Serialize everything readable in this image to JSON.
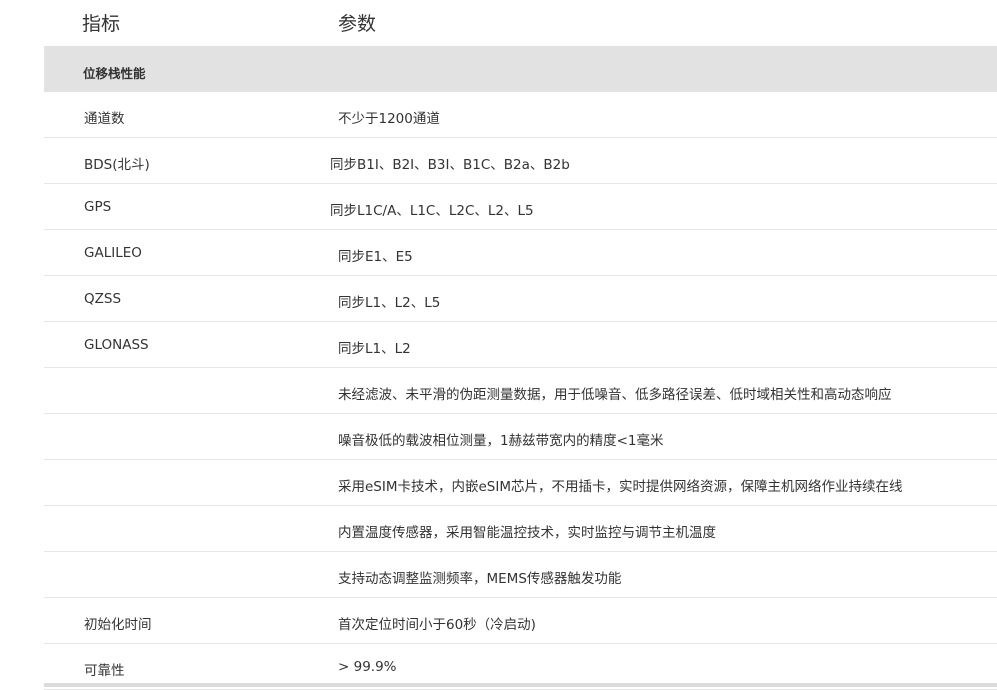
{
  "header": {
    "col1": "指标",
    "col2": "参数"
  },
  "section": {
    "label": "位移栈性能"
  },
  "rows": [
    {
      "name": "通道数",
      "value": "不少于1200通道"
    },
    {
      "name": "BDS(北斗)",
      "value": "同步B1I、B2I、B3I、B1C、B2a、B2b"
    },
    {
      "name": "GPS",
      "value": "同步L1C/A、L1C、L2C、L2、L5"
    },
    {
      "name": "GALILEO",
      "value": "同步E1、E5"
    },
    {
      "name": "QZSS",
      "value": "同步L1、L2、L5"
    },
    {
      "name": "GLONASS",
      "value": "同步L1、L2"
    },
    {
      "name": "",
      "value": "未经滤波、未平滑的伪距测量数据，用于低噪音、低多路径误差、低时域相关性和高动态响应"
    },
    {
      "name": "",
      "value": "噪音极低的载波相位测量，1赫兹带宽内的精度<1毫米"
    },
    {
      "name": "",
      "value": "采用eSIM卡技术，内嵌eSIM芯片，不用插卡，实时提供网络资源，保障主机网络作业持续在线"
    },
    {
      "name": "",
      "value": "内置温度传感器，采用智能温控技术，实时监控与调节主机温度"
    },
    {
      "name": "",
      "value": "支持动态调整监测频率，MEMS传感器触发功能"
    },
    {
      "name": "初始化时间",
      "value": "首次定位时间小于60秒（冷启动)"
    },
    {
      "name": "可靠性",
      "value": "> 99.9%"
    }
  ]
}
